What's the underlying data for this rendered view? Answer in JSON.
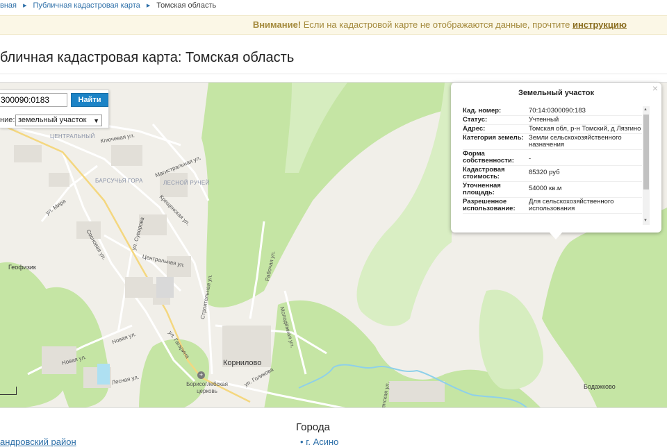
{
  "breadcrumbs": [
    {
      "label": "вная"
    },
    {
      "label": "Публичная кадастровая карта"
    },
    {
      "label": "Томская область"
    }
  ],
  "notice": {
    "strong": "Внимание!",
    "text": "Если на кадастровой карте не отображаются данные, прочтите",
    "link": "инструкцию"
  },
  "page_title": "бличная кадастровая карта: Томская область",
  "search": {
    "value": "300090:0183",
    "button": "Найти",
    "type_label": "ние:",
    "type_value": "земельный участок"
  },
  "map": {
    "labels": {
      "centralny": "ЦЕНТРАЛЬНЫЙ",
      "barsuchya": "БАРСУЧЬЯ ГОРА",
      "lesnoy": "ЛЕСНОЙ РУЧЕЙ",
      "klyuchevaya": "Ключевая ул.",
      "magistralnaya": "Магистральная ул.",
      "mira": "ул. Мира",
      "kreschenskaya": "Крещенская ул.",
      "suvorova": "ул. Суворова",
      "sosnovaya": "Сосновая ул.",
      "centralnaya": "Центральная ул.",
      "geofizik": "Геофизик",
      "stroitelnaya": "Строительная ул.",
      "rabochaya": "Рабочая ул.",
      "molodezhnaya": "Молодёжная ул.",
      "novaya1": "Новая ул.",
      "novaya2": "Новая ул.",
      "gagarina": "ул. Гагарина",
      "lesnaya": "Лесная ул.",
      "kornilovo": "Корнилово",
      "church": "Борисоглебская церковь",
      "golikova": "ул. Голикова",
      "enskaya": "енская ул.",
      "bodazhkovo": "Бодажково"
    }
  },
  "popup": {
    "title": "Земельный участок",
    "close": "×",
    "rows": [
      {
        "key": "Кад. номер:",
        "value": "70:14:0300090:183"
      },
      {
        "key": "Статус:",
        "value": "Учтенный"
      },
      {
        "key": "Адрес:",
        "value": "Томская обл, р-н Томский, д Лязгино"
      },
      {
        "key": "Категория земель:",
        "value": "Земли сельскохозяйственного назначения"
      },
      {
        "key": "Форма собственности:",
        "value": "-"
      },
      {
        "key": "Кадастровая стоимость:",
        "value": "85320 руб"
      },
      {
        "key": "Уточненная площадь:",
        "value": "54000 кв.м"
      },
      {
        "key": "Разрешенное использование:",
        "value": "Для сельскохозяйственного использования"
      }
    ]
  },
  "footer": {
    "cities_title": "Города",
    "left_link": "андровский район",
    "city_link": "г. Асино"
  },
  "colors": {
    "link": "#2d6fa8",
    "button": "#1c83c6",
    "forest": "#c5e5a4",
    "land": "#f1efe9",
    "notice_bg": "#fbf7e6"
  }
}
